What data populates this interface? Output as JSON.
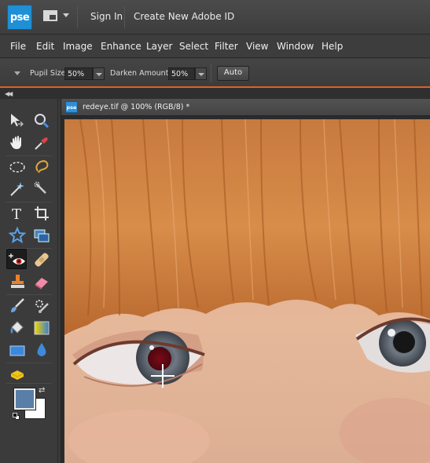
{
  "app": {
    "logo_text": "pse",
    "top_links": {
      "sign_in": "Sign In",
      "create_id": "Create New Adobe ID"
    }
  },
  "menu": {
    "items": [
      "File",
      "Edit",
      "Image",
      "Enhance",
      "Layer",
      "Select",
      "Filter",
      "View",
      "Window",
      "Help"
    ]
  },
  "options": {
    "pupil_size_label": "Pupil Size:",
    "pupil_size_value": "50%",
    "darken_amount_label": "Darken Amount:",
    "darken_amount_value": "50%",
    "auto_label": "Auto"
  },
  "toolbox": {
    "tools": [
      "move-tool",
      "zoom-tool",
      "hand-tool",
      "eyedropper-tool",
      "marquee-tool",
      "lasso-tool",
      "magic-wand-tool",
      "quick-selection-tool",
      "type-tool",
      "crop-tool",
      "cookie-cutter-tool",
      "straighten-tool",
      "red-eye-removal-tool",
      "healing-brush-tool",
      "clone-stamp-tool",
      "eraser-tool",
      "brush-tool",
      "smart-brush-tool",
      "paint-bucket-tool",
      "gradient-tool",
      "shape-tool",
      "blur-tool",
      "sponge-tool"
    ],
    "active_tool": "red-eye-removal-tool",
    "foreground_color": "#5a7fa6",
    "background_color": "#ffffff"
  },
  "document": {
    "icon_text": "pse",
    "title": "redeye.tif @ 100% (RGB/8) *"
  },
  "colors": {
    "accent": "#e0621e",
    "brand": "#1f8fd6"
  }
}
